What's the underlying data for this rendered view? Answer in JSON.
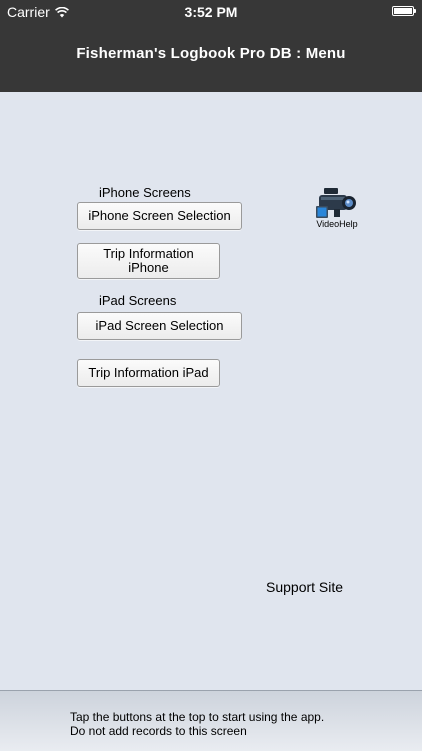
{
  "status": {
    "carrier": "Carrier",
    "time": "3:52 PM"
  },
  "header": {
    "title": "Fisherman's Logbook Pro DB : Menu"
  },
  "iphone_section": {
    "label": "iPhone Screens",
    "selection_button": "iPhone Screen Selection",
    "trip_button_line1": "Trip Information",
    "trip_button_line2": "iPhone"
  },
  "ipad_section": {
    "label": "iPad Screens",
    "selection_button": "iPad Screen Selection",
    "trip_button": "Trip Information iPad"
  },
  "videohelp": {
    "label": "VideoHelp",
    "icon": "video-camera-icon"
  },
  "support": {
    "label": "Support Site"
  },
  "footer": {
    "line1": "Tap the buttons at the top to start using the app.",
    "line2": "Do not add records to this screen"
  },
  "colors": {
    "header_bg": "#373737",
    "page_bg": "#e0e5ee"
  }
}
